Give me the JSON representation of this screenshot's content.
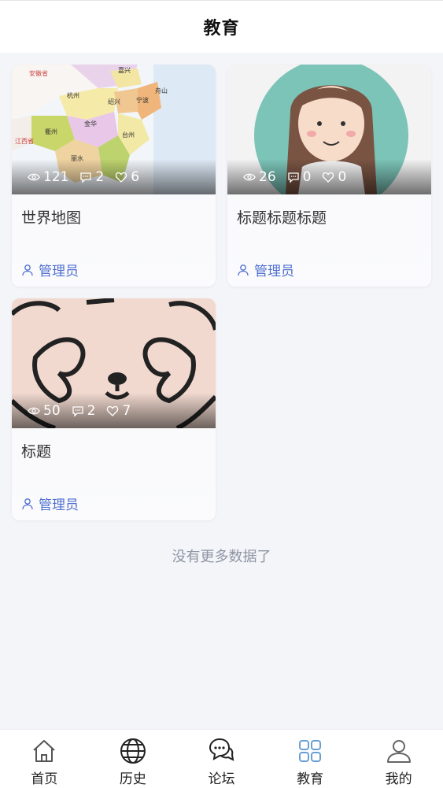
{
  "header": {
    "title": "教育"
  },
  "cards": [
    {
      "title": "世界地图",
      "views": "121",
      "comments": "2",
      "likes": "6",
      "author": "管理员"
    },
    {
      "title": "标题标题标题",
      "views": "26",
      "comments": "0",
      "likes": "0",
      "author": "管理员"
    },
    {
      "title": "标题",
      "views": "50",
      "comments": "2",
      "likes": "7",
      "author": "管理员"
    }
  ],
  "map_labels": [
    "安徽省",
    "嘉兴",
    "杭州",
    "绍兴",
    "宁波",
    "舟山",
    "衢州",
    "金华",
    "台州",
    "丽水",
    "江西省"
  ],
  "footer_text": "没有更多数据了",
  "tabbar": {
    "items": [
      {
        "label": "首页",
        "icon": "home-icon"
      },
      {
        "label": "历史",
        "icon": "globe-icon"
      },
      {
        "label": "论坛",
        "icon": "chat-icon"
      },
      {
        "label": "教育",
        "icon": "grid-icon",
        "active": true
      },
      {
        "label": "我的",
        "icon": "user-icon"
      }
    ]
  },
  "colors": {
    "accent": "#4f6fd0",
    "active_tab": "#6b9fd4"
  }
}
